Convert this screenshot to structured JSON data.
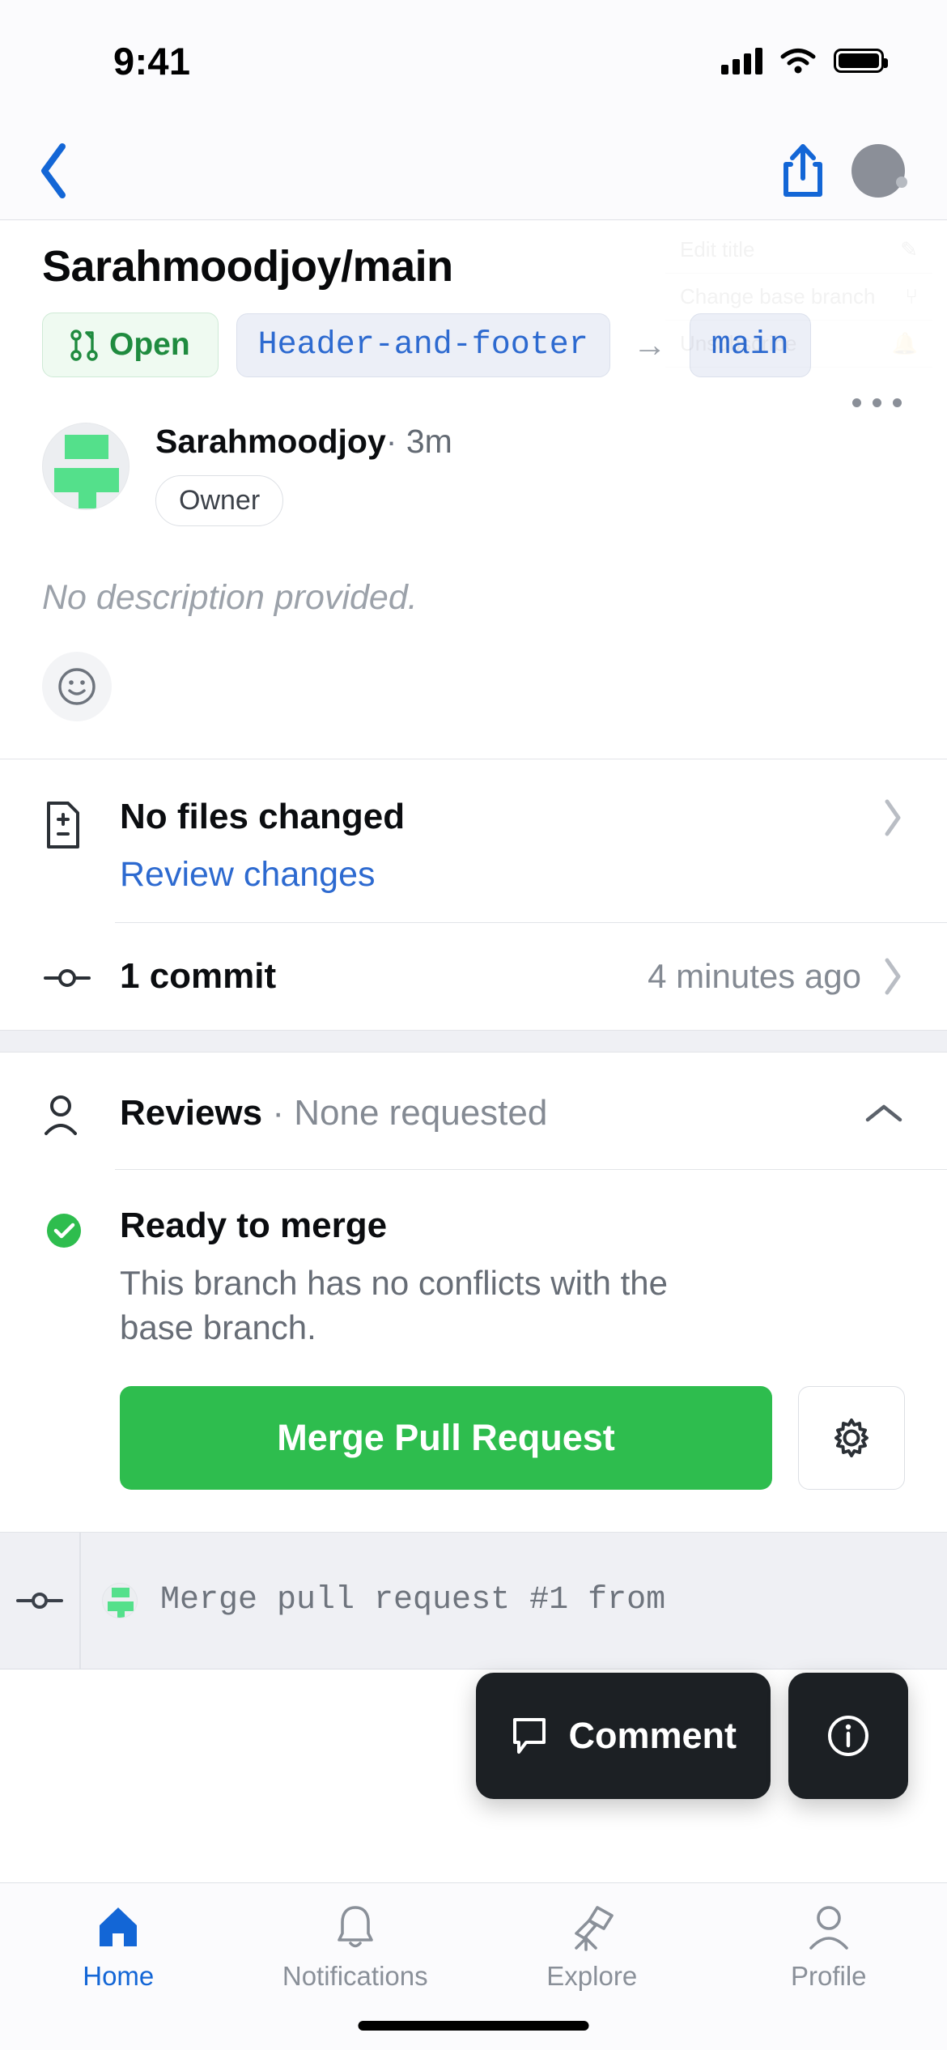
{
  "status_bar": {
    "time": "9:41",
    "signal_icon": "cellular-signal-icon",
    "wifi_icon": "wifi-icon",
    "battery_icon": "battery-icon"
  },
  "nav_bar": {
    "back_icon": "chevron-left-icon",
    "share_icon": "share-icon",
    "avatar": "user-avatar"
  },
  "pull_request": {
    "title": "Sarahmoodjoy/main",
    "state_label": "Open",
    "state_icon": "git-pull-request-icon",
    "head_branch": "Header-and-footer",
    "arrow": "→",
    "base_branch": "main",
    "author": "Sarahmoodjoy",
    "separator": "·",
    "time_ago": "3m",
    "role_badge": "Owner",
    "overflow_icon": "more-horizontal-icon",
    "description": "No description provided.",
    "reaction_icon": "smiley-reaction-icon"
  },
  "ghost_menu": {
    "items": [
      {
        "label": "Edit title",
        "icon": "pencil-icon"
      },
      {
        "label": "Change base branch",
        "icon": "branch-icon"
      },
      {
        "label": "Unsubscribe",
        "icon": "bell-slash-icon"
      }
    ]
  },
  "files": {
    "icon": "file-diff-icon",
    "title": "No files changed",
    "link": "Review changes",
    "chevron": "chevron-right-icon"
  },
  "commits": {
    "icon": "git-commit-icon",
    "title": "1 commit",
    "time": "4 minutes ago",
    "chevron": "chevron-right-icon"
  },
  "reviews": {
    "icon": "person-icon",
    "title": "Reviews",
    "separator": "·",
    "status": "None requested",
    "collapse_icon": "chevron-up-icon"
  },
  "merge": {
    "status_icon": "check-circle-icon",
    "title": "Ready to merge",
    "subtitle": "This branch has no conflicts with the base branch.",
    "button_label": "Merge Pull Request",
    "settings_icon": "gear-icon"
  },
  "timeline": {
    "icon": "git-commit-icon",
    "avatar": "author-avatar",
    "text": "Merge pull request #1 from"
  },
  "floating": {
    "comment_label": "Comment",
    "comment_icon": "comment-icon",
    "info_icon": "info-circle-icon"
  },
  "tab_bar": {
    "tabs": [
      {
        "label": "Home",
        "icon": "home-icon",
        "active": true
      },
      {
        "label": "Notifications",
        "icon": "bell-icon",
        "active": false
      },
      {
        "label": "Explore",
        "icon": "telescope-icon",
        "active": false
      },
      {
        "label": "Profile",
        "icon": "person-icon",
        "active": false
      }
    ]
  },
  "colors": {
    "accent_blue": "#1366d6",
    "link_blue": "#2d6ad0",
    "merge_green": "#2ebd4e",
    "open_green": "#1f8b3f",
    "section_grey": "#eff0f4"
  }
}
